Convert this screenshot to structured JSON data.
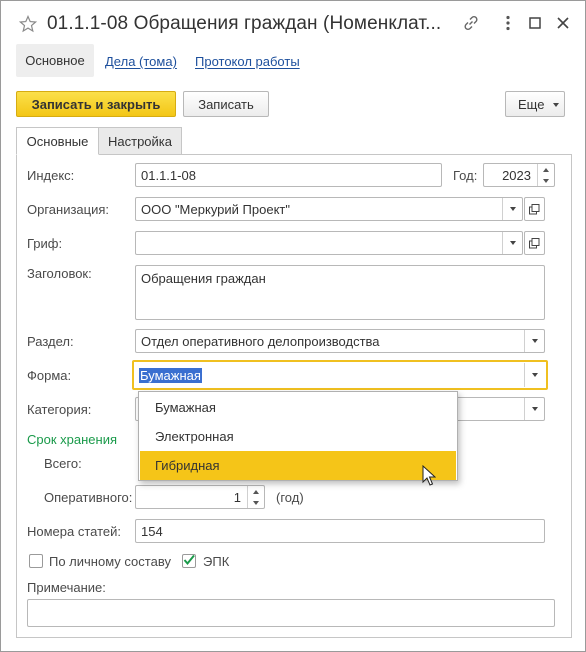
{
  "window": {
    "title": "01.1.1-08 Обращения граждан (Номенклат...",
    "icons": [
      "star-icon",
      "link-icon",
      "more-icon",
      "maximize-icon",
      "close-icon"
    ]
  },
  "navbar": {
    "items": [
      {
        "label": "Основное",
        "active": true
      },
      {
        "label": "Дела (тома)"
      },
      {
        "label": "Протокол работы"
      }
    ]
  },
  "toolbar": {
    "save_close_label": "Записать и закрыть",
    "save_label": "Записать",
    "more_label": "Еще"
  },
  "tabs": [
    {
      "label": "Основные",
      "active": true
    },
    {
      "label": "Настройка"
    }
  ],
  "form": {
    "index_label": "Индекс:",
    "index_value": "01.1.1-08",
    "year_label": "Год:",
    "year_value": "2023",
    "org_label": "Организация:",
    "org_value": "ООО \"Меркурий Проект\"",
    "grif_label": "Гриф:",
    "grif_value": "",
    "header_label": "Заголовок:",
    "header_value": "Обращения граждан",
    "section_label": "Раздел:",
    "section_value": "Отдел оперативного делопроизводства",
    "form_label": "Форма:",
    "form_value": "Бумажная",
    "category_label": "Категория:",
    "storage_group_label": "Срок хранения",
    "total_label": "Всего:",
    "operative_label": "Оперативного:",
    "operative_value": "1",
    "operative_unit": "(год)",
    "article_label": "Номера статей:",
    "article_value": "154",
    "personal_label": "По личному составу",
    "personal_checked": false,
    "epk_label": "ЭПК",
    "epk_checked": true,
    "note_label": "Примечание:",
    "note_value": ""
  },
  "dropdown": {
    "options": [
      "Бумажная",
      "Электронная",
      "Гибридная"
    ],
    "highlighted": "Гибридная"
  },
  "colors": {
    "accent_yellow": "#f3c616",
    "link_blue": "#1d4f9c",
    "group_green": "#1a9a4a",
    "selection_blue": "#3a6fd0",
    "highlight_yellow": "#f5c518",
    "focus_border": "#f0c020"
  }
}
